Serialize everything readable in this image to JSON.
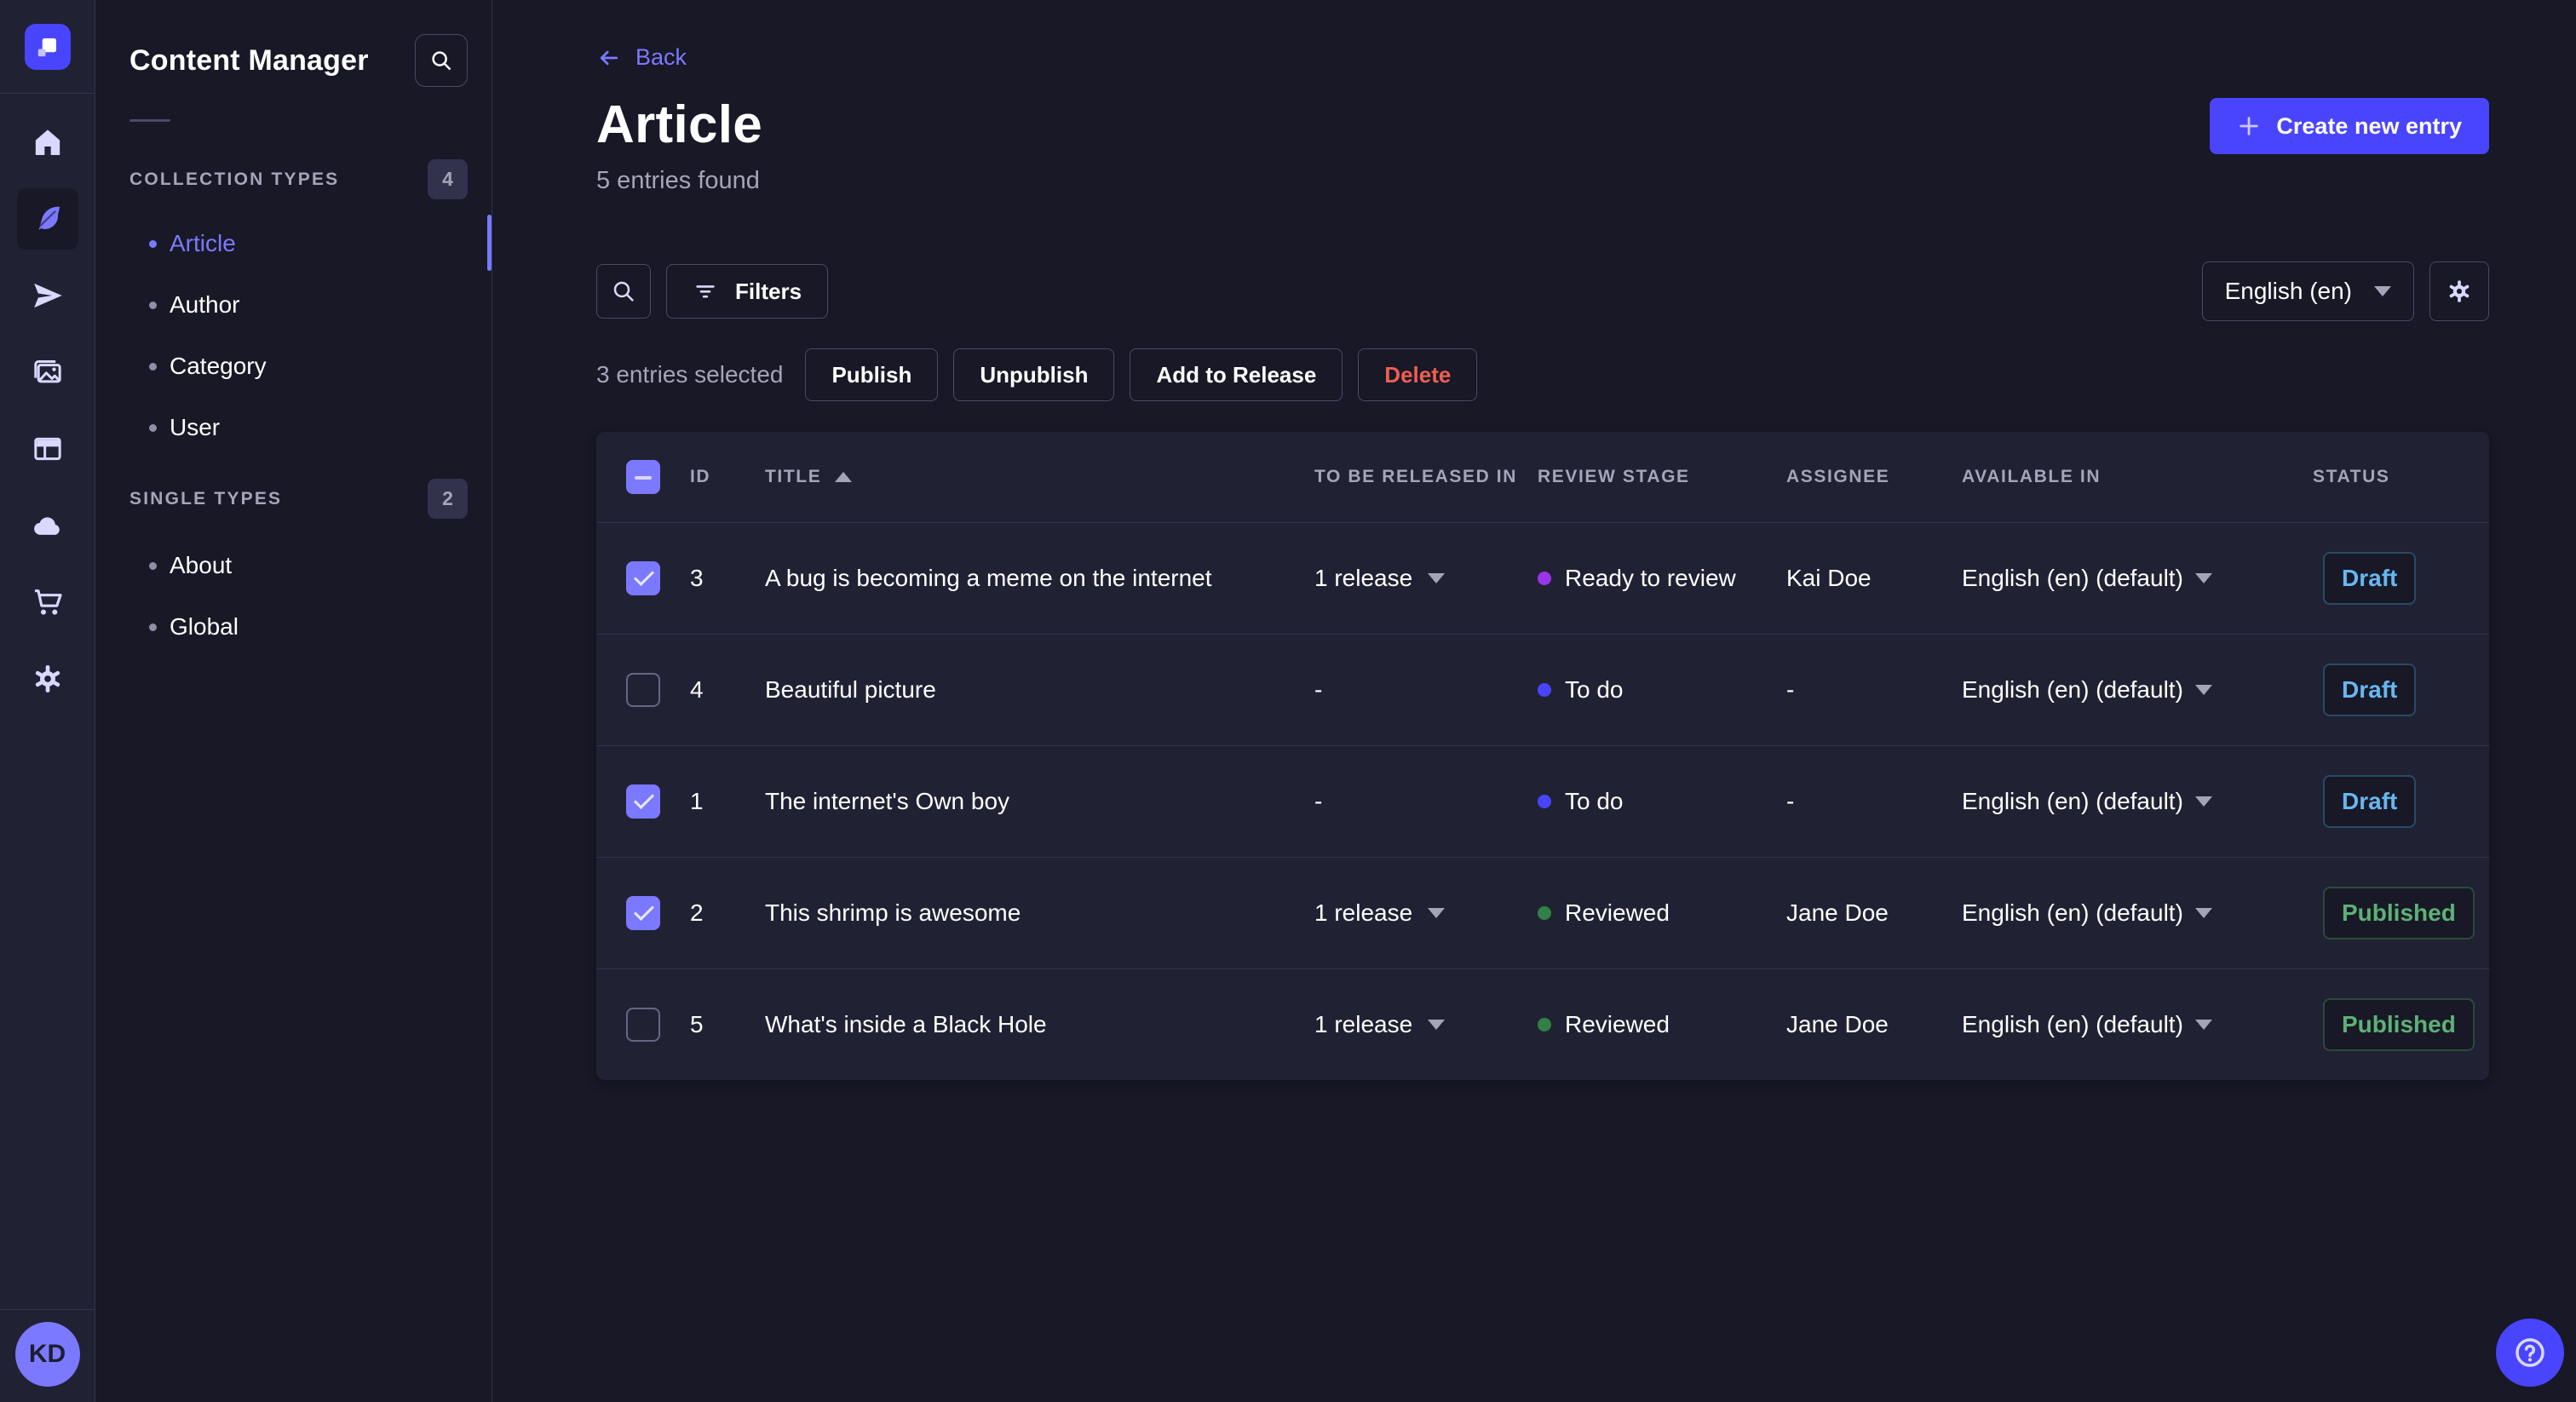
{
  "subnav": {
    "title": "Content Manager",
    "sections": [
      {
        "label": "COLLECTION TYPES",
        "count": "4",
        "items": [
          {
            "label": "Article",
            "active": true
          },
          {
            "label": "Author",
            "active": false
          },
          {
            "label": "Category",
            "active": false
          },
          {
            "label": "User",
            "active": false
          }
        ]
      },
      {
        "label": "SINGLE TYPES",
        "count": "2",
        "items": [
          {
            "label": "About",
            "active": false
          },
          {
            "label": "Global",
            "active": false
          }
        ]
      }
    ]
  },
  "header": {
    "back_label": "Back",
    "title": "Article",
    "subtitle": "5 entries found",
    "create_button_label": "Create new entry"
  },
  "toolbar": {
    "filters_label": "Filters",
    "locale_value": "English (en)"
  },
  "selection": {
    "count_label": "3 entries selected",
    "publish_label": "Publish",
    "unpublish_label": "Unpublish",
    "add_to_release_label": "Add to Release",
    "delete_label": "Delete"
  },
  "table": {
    "headers": {
      "id": "ID",
      "title": "TITLE",
      "to_be_released_in": "TO BE RELEASED IN",
      "review_stage": "REVIEW STAGE",
      "assignee": "ASSIGNEE",
      "available_in": "AVAILABLE IN",
      "status": "STATUS"
    },
    "sort_column": "title",
    "sort_direction": "asc",
    "rows": [
      {
        "checked": true,
        "id": "3",
        "title": "A bug is becoming a meme on the internet",
        "to_be_released_in": "1 release",
        "review_stage": "Ready to review",
        "review_stage_color": "#9736e8",
        "assignee": "Kai Doe",
        "available_in": "English (en) (default)",
        "status": "Draft"
      },
      {
        "checked": false,
        "id": "4",
        "title": "Beautiful picture",
        "to_be_released_in": "-",
        "review_stage": "To do",
        "review_stage_color": "#4945ff",
        "assignee": "-",
        "available_in": "English (en) (default)",
        "status": "Draft"
      },
      {
        "checked": true,
        "id": "1",
        "title": "The internet's Own boy",
        "to_be_released_in": "-",
        "review_stage": "To do",
        "review_stage_color": "#4945ff",
        "assignee": "-",
        "available_in": "English (en) (default)",
        "status": "Draft"
      },
      {
        "checked": true,
        "id": "2",
        "title": "This shrimp is awesome",
        "to_be_released_in": "1 release",
        "review_stage": "Reviewed",
        "review_stage_color": "#328048",
        "assignee": "Jane Doe",
        "available_in": "English (en) (default)",
        "status": "Published"
      },
      {
        "checked": false,
        "id": "5",
        "title": "What's inside a Black Hole",
        "to_be_released_in": "1 release",
        "review_stage": "Reviewed",
        "review_stage_color": "#328048",
        "assignee": "Jane Doe",
        "available_in": "English (en) (default)",
        "status": "Published"
      }
    ]
  },
  "user": {
    "initials": "KD"
  },
  "colors": {
    "accent": "#4945ff",
    "active_link": "#7b79ff",
    "draft_text": "#66b7f1",
    "published_text": "#5cb176",
    "delete_text": "#ee5e52",
    "stage_todo": "#4945ff",
    "stage_ready_to_review": "#9736e8",
    "stage_reviewed": "#328048",
    "page_background": "#181826",
    "surface_background": "#212134"
  }
}
